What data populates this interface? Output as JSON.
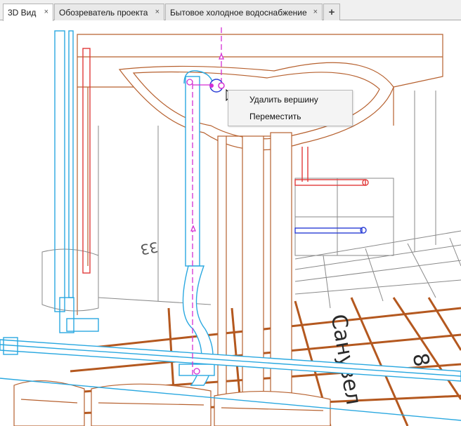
{
  "tabs": [
    {
      "label": "3D Вид",
      "close": "×",
      "active": true
    },
    {
      "label": "Обозреватель проекта",
      "close": "×",
      "active": false
    },
    {
      "label": "Бытовое холодное водоснабжение",
      "close": "×",
      "active": false
    }
  ],
  "add_tab": "+",
  "context_menu": {
    "items": [
      "Удалить вершину",
      "Переместить"
    ]
  },
  "floor_labels": [
    "Санузел",
    "8",
    "33"
  ],
  "colors": {
    "cold_water_pipe": "#2aa8e0",
    "hot_water_pipe": "#e03a3a",
    "sewer_pipe": "#2b3fd6",
    "selection": "#d42fd4",
    "structure_edges": "#b6602e",
    "floor_grid": "#b4581f"
  },
  "icons": [
    "close-icon",
    "plus-icon",
    "mouse-pointer-icon",
    "pipe-vertex-icon"
  ]
}
